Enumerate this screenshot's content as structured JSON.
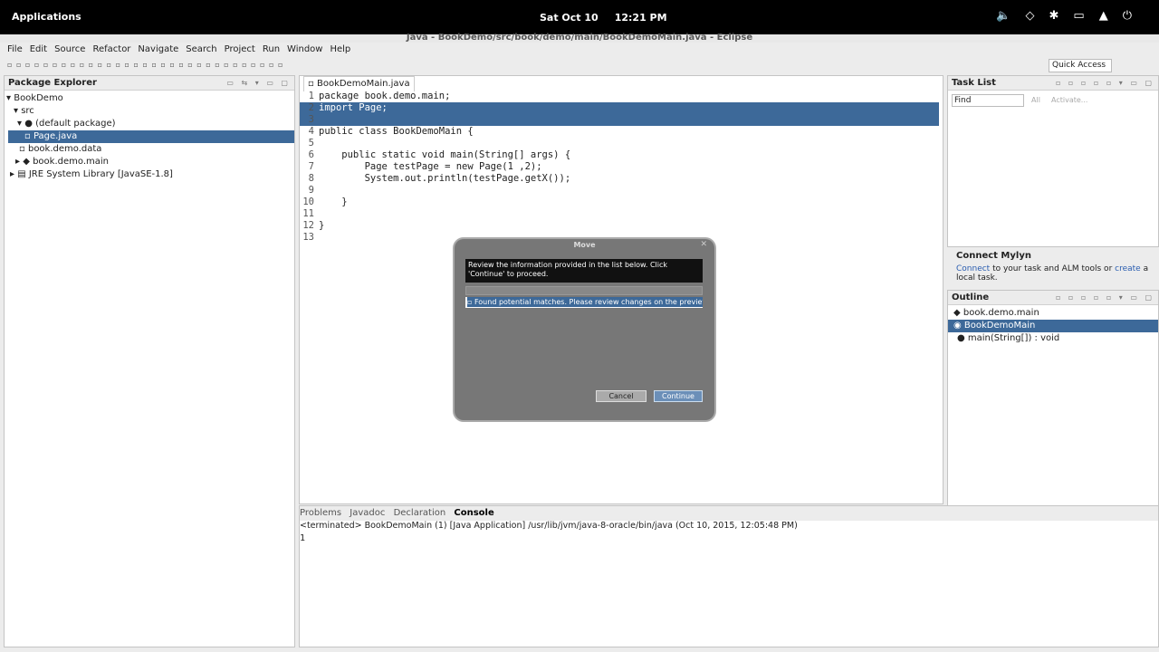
{
  "topbar": {
    "apps": "Applications",
    "date": "Sat Oct 10",
    "time": "12:21 PM"
  },
  "window": {
    "title": "Java - BookDemo/src/book/demo/main/BookDemoMain.java - Eclipse"
  },
  "menu": [
    "File",
    "Edit",
    "Source",
    "Refactor",
    "Navigate",
    "Search",
    "Project",
    "Run",
    "Window",
    "Help"
  ],
  "toolbar": {
    "quick_access": "Quick Access"
  },
  "package_explorer": {
    "title": "Package Explorer",
    "items": [
      "BookDemo",
      "src",
      "(default package)",
      "Page.java",
      "book.demo.data",
      "book.demo.main",
      "JRE System Library [JavaSE-1.8]"
    ]
  },
  "editor": {
    "tab": "BookDemoMain.java",
    "lines": [
      {
        "n": "1",
        "t": "package book.demo.main;"
      },
      {
        "n": "2",
        "t": "import Page;"
      },
      {
        "n": "3",
        "t": ""
      },
      {
        "n": "4",
        "t": "public class BookDemoMain {"
      },
      {
        "n": "5",
        "t": ""
      },
      {
        "n": "6",
        "t": "    public static void main(String[] args) {"
      },
      {
        "n": "7",
        "t": "        Page testPage = new Page(1 ,2);"
      },
      {
        "n": "8",
        "t": "        System.out.println(testPage.getX());"
      },
      {
        "n": "9",
        "t": ""
      },
      {
        "n": "10",
        "t": "    }"
      },
      {
        "n": "11",
        "t": ""
      },
      {
        "n": "12",
        "t": "}"
      },
      {
        "n": "13",
        "t": ""
      }
    ]
  },
  "task_list": {
    "title": "Task List",
    "find": "Find",
    "all": "All",
    "activate": "Activate..."
  },
  "mylyn": {
    "title": "Connect Mylyn",
    "connect": "Connect",
    "text1": " to your task and ALM tools or ",
    "create": "create",
    "text2": " a",
    "text3": "local task."
  },
  "outline": {
    "title": "Outline",
    "items": [
      "book.demo.main",
      "BookDemoMain",
      "main(String[]) : void"
    ]
  },
  "console": {
    "tabs": [
      "Problems",
      "Javadoc",
      "Declaration",
      "Console"
    ],
    "status": "<terminated> BookDemoMain (1) [Java Application] /usr/lib/jvm/java-8-oracle/bin/java (Oct 10, 2015, 12:05:48 PM)",
    "output": "1"
  },
  "dialog": {
    "title": "Move",
    "header": "Review the information provided in the list below. Click 'Continue' to proceed.",
    "list_item": "Found potential matches. Please review changes on the preview pag",
    "cancel": "Cancel",
    "continue": "Continue"
  }
}
